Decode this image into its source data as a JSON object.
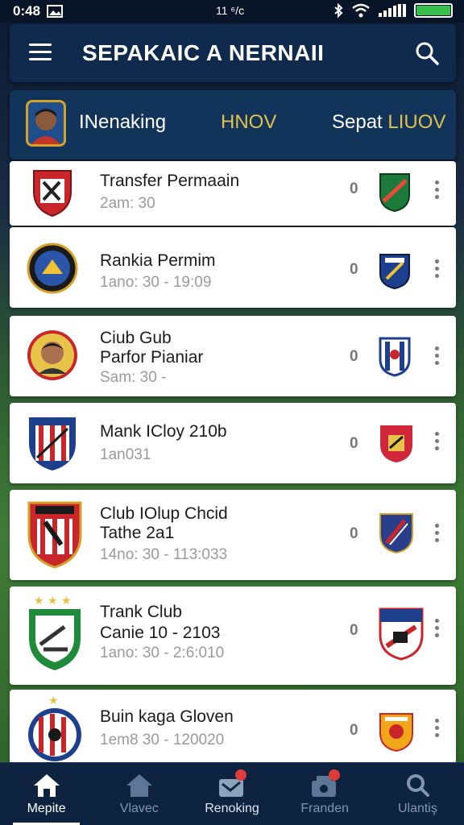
{
  "status_bar": {
    "time": "0:48",
    "center_text": "11 ⁶/ᴄ",
    "icons": [
      "image-icon",
      "bluetooth-icon",
      "wifi-icon",
      "signal-icon",
      "battery-icon"
    ]
  },
  "app_bar": {
    "title": "SEPAKAIC A NERNAII",
    "menu_icon": "menu-icon",
    "search_icon": "search-icon"
  },
  "sub_header": {
    "tab1": "INenaking",
    "tab2": "HNOV",
    "tab3_prefix": "Sepat ",
    "tab3_highlight": "LIUOV"
  },
  "items": [
    {
      "title": "Transfer Permaain",
      "time": "2am: 30",
      "score": "0"
    },
    {
      "title": "Rankia Permim",
      "time": "1ano: 30  -  19:09",
      "score": "0"
    },
    {
      "title_line1": "Ciub Gub",
      "title_line2": "Parfor Pianiar",
      "time": "Sam: 30  -",
      "score": "0"
    },
    {
      "title": "Mank ICloy 210b",
      "time": "1an031",
      "score": "0"
    },
    {
      "title_line1": "Club IOlup Chcid",
      "title_line2": "Tathe 2a1",
      "time": "14no: 30  -  113:033",
      "score": "0"
    },
    {
      "title_line1": "Trank Club",
      "title_line2": "Canie 10  -  2103",
      "time": "1ano: 30  -  2:6:010",
      "score": "0"
    },
    {
      "title": "Buin kaga Gloven",
      "time": "1em8 30  -  120020",
      "score": "0"
    }
  ],
  "bottom_nav": [
    {
      "label": "Mepite",
      "icon": "home-icon",
      "active": true
    },
    {
      "label": "Vlavec",
      "icon": "home-outline-icon"
    },
    {
      "label": "Renoking",
      "icon": "ranking-icon"
    },
    {
      "label": "Franden",
      "icon": "friends-icon"
    },
    {
      "label": "Ulantiş",
      "icon": "search-icon"
    }
  ],
  "colors": {
    "app_bar": "#0f2a4d",
    "accent_gold": "#e2c24a",
    "nav_bg": "#0d2340",
    "badge_red": "#e03b3b"
  }
}
